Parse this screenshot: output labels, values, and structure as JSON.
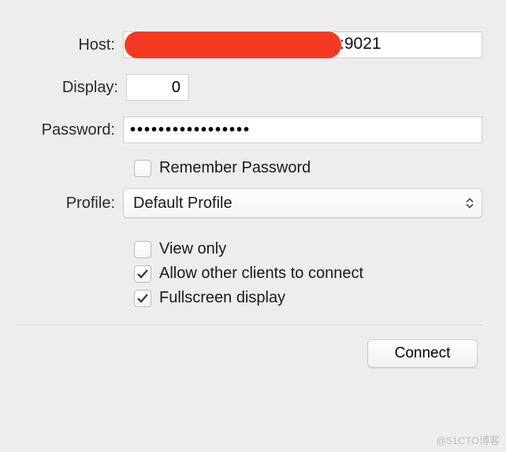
{
  "labels": {
    "host": "Host:",
    "display": "Display:",
    "password": "Password:",
    "profile": "Profile:"
  },
  "host": {
    "value": "",
    "port_suffix": ":9021"
  },
  "display": {
    "value": "0"
  },
  "password": {
    "value": "•••••••••••••••••"
  },
  "remember": {
    "label": "Remember Password",
    "checked": false
  },
  "profile": {
    "selected": "Default Profile"
  },
  "options": {
    "view_only": {
      "label": "View only",
      "checked": false
    },
    "allow_others": {
      "label": "Allow other clients to connect",
      "checked": true
    },
    "fullscreen": {
      "label": "Fullscreen display",
      "checked": true
    }
  },
  "buttons": {
    "connect": "Connect"
  },
  "watermark": "@51CTO博客"
}
